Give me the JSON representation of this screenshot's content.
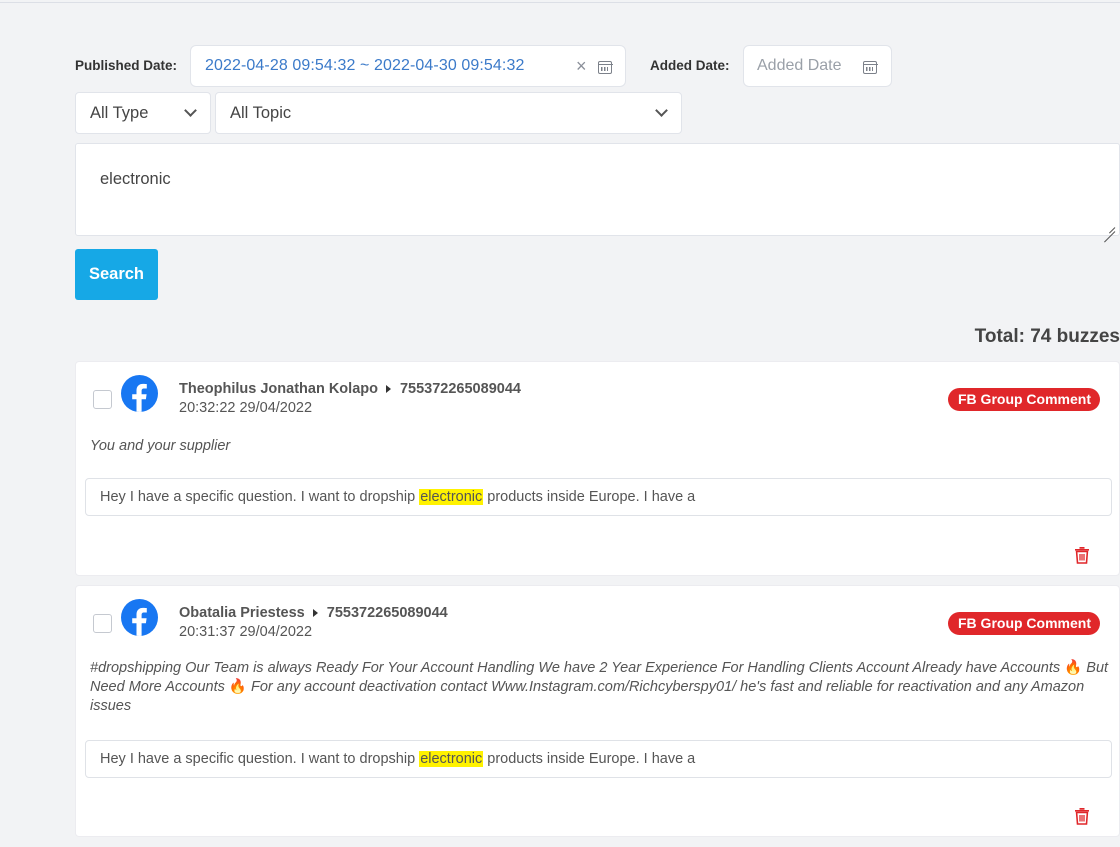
{
  "filters": {
    "published_label": "Published Date:",
    "published_value": "2022-04-28 09:54:32 ~ 2022-04-30 09:54:32",
    "clear_glyph": "×",
    "added_label": "Added Date:",
    "added_placeholder": "Added Date",
    "type_value": "All Type",
    "topic_value": "All Topic",
    "keyword_value": "electronic",
    "search_label": "Search"
  },
  "results": {
    "total_text": "Total: 74 buzzes",
    "items": [
      {
        "author": "Theophilus Jonathan Kolapo",
        "group_id": "755372265089044",
        "time": "20:32:22 29/04/2022",
        "badge": "FB Group Comment",
        "post_text": "You and your supplier",
        "quote_before": "Hey I have a specific question. I want to dropship ",
        "quote_highlight": "electronic",
        "quote_after": " products inside Europe. I have a"
      },
      {
        "author": "Obatalia Priestess",
        "group_id": "755372265089044",
        "time": "20:31:37 29/04/2022",
        "badge": "FB Group Comment",
        "post_part1": "#dropshipping Our Team is always Ready For Your Account Handling We have 2 Year Experience For Handling Clients Account Already have Accounts ",
        "post_part2": " But Need More Accounts ",
        "post_part3": " For any account deactivation contact Www.Instagram.com/Richcyberspy01/ he's fast and reliable for reactivation and any Amazon issues",
        "flame": "🔥",
        "quote_before": "Hey I have a specific question. I want to dropship ",
        "quote_highlight": "electronic",
        "quote_after": " products inside Europe. I have a"
      }
    ]
  },
  "colors": {
    "accent": "#16a8e6",
    "badge": "#e0272a",
    "highlight": "#fff200",
    "facebook": "#1877f2",
    "date_text": "#3b7ac9"
  },
  "icons": [
    "calendar-icon",
    "clear-icon",
    "chevron-down-icon",
    "facebook-icon",
    "caret-right-icon",
    "trash-icon",
    "resize-handle-icon"
  ]
}
